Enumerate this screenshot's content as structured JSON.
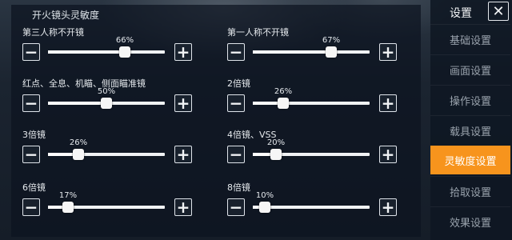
{
  "section_title": "开火镜头灵敏度",
  "sliders": [
    {
      "label": "第三人称不开镜",
      "percent_text": "66%",
      "value": 66
    },
    {
      "label": "第一人称不开镜",
      "percent_text": "67%",
      "value": 67
    },
    {
      "label": "红点、全息、机瞄、侧面瞄准镜",
      "percent_text": "50%",
      "value": 50
    },
    {
      "label": "2倍镜",
      "percent_text": "26%",
      "value": 26
    },
    {
      "label": "3倍镜",
      "percent_text": "26%",
      "value": 26
    },
    {
      "label": "4倍镜、VSS",
      "percent_text": "20%",
      "value": 20
    },
    {
      "label": "6倍镜",
      "percent_text": "17%",
      "value": 17
    },
    {
      "label": "8倍镜",
      "percent_text": "10%",
      "value": 10
    }
  ],
  "buttons": {
    "minus": "−",
    "plus": "+"
  },
  "menu": {
    "title": "设置",
    "close_symbol": "✕",
    "items": [
      {
        "label": "基础设置",
        "active": false
      },
      {
        "label": "画面设置",
        "active": false
      },
      {
        "label": "操作设置",
        "active": false
      },
      {
        "label": "载具设置",
        "active": false
      },
      {
        "label": "灵敏度设置",
        "active": true
      },
      {
        "label": "拾取设置",
        "active": false
      },
      {
        "label": "效果设置",
        "active": false
      }
    ]
  },
  "colors": {
    "accent": "#f7941d"
  }
}
